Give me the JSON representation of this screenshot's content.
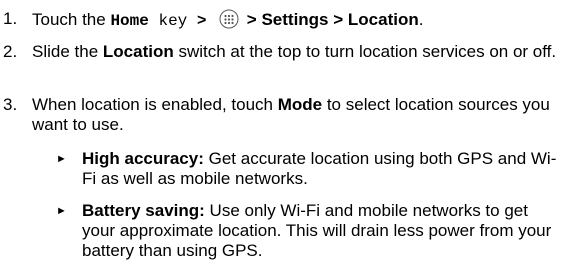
{
  "steps": [
    {
      "number": "1.",
      "part_touch": "Touch the ",
      "home_word": "Home",
      "key_word": " key",
      "sep1": " > ",
      "apps_icon": "apps-grid-icon",
      "sep2": " > ",
      "settings_location": "Settings > Location",
      "end": "."
    },
    {
      "number": "2.",
      "part_a": "Slide the ",
      "location_bold": "Location",
      "part_b": " switch at the top to turn location services on or off."
    },
    {
      "number": "3.",
      "part_a": "When location is enabled, touch ",
      "mode_bold": "Mode",
      "part_b": " to select location sources you want to use."
    }
  ],
  "bullet_glyph": "►",
  "modes": [
    {
      "title": "High accuracy:",
      "desc": " Get accurate location using both GPS and Wi-Fi as well as mobile networks."
    },
    {
      "title": "Battery saving:",
      "desc": " Use only Wi-Fi and mobile networks to get your approximate location. This will drain less power from your battery than using GPS."
    }
  ]
}
